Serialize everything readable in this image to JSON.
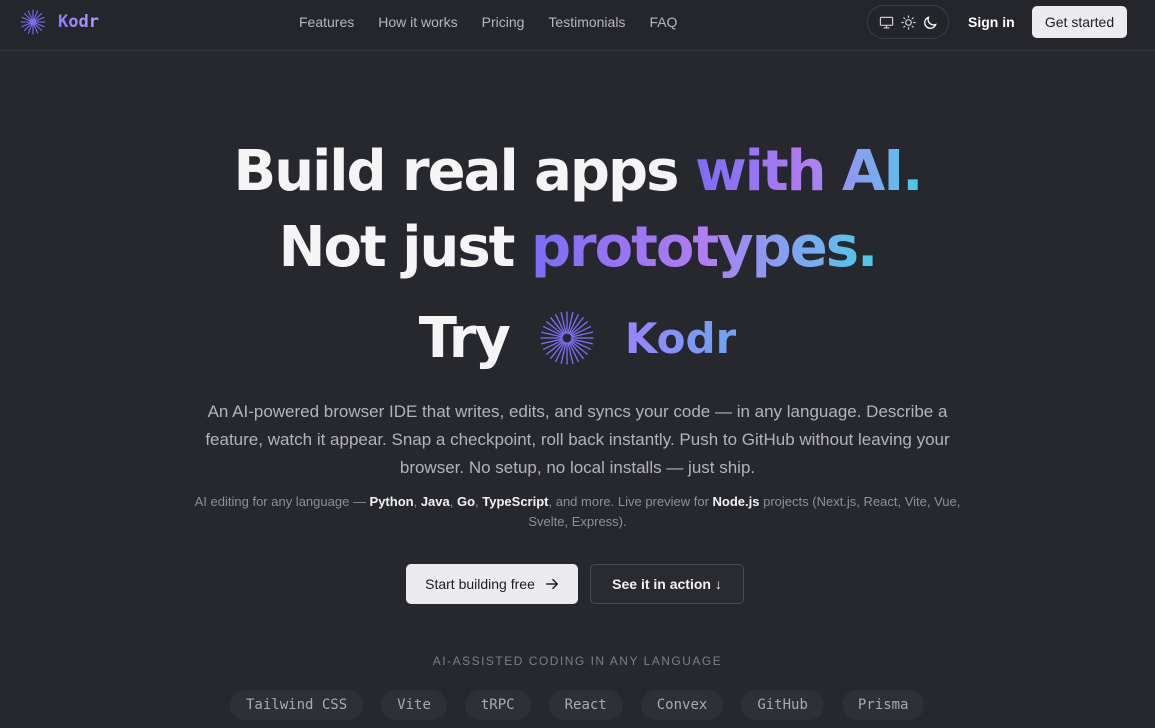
{
  "brand": {
    "name": "Kodr",
    "logo_icon": "starburst-icon"
  },
  "nav": {
    "links": [
      "Features",
      "How it works",
      "Pricing",
      "Testimonials",
      "FAQ"
    ],
    "theme_icons": [
      "monitor-icon",
      "sun-icon",
      "moon-icon"
    ],
    "sign_in": "Sign in",
    "get_started": "Get started"
  },
  "hero": {
    "line1_plain": "Build real apps",
    "line1_accent": "with AI.",
    "line2_plain": "Not just",
    "line2_accent": "prototypes.",
    "try_word": "Try",
    "try_brand": "Kodr",
    "description": "An AI-powered browser IDE that writes, edits, and syncs your code — in any language. Describe a feature, watch it appear. Snap a checkpoint, roll back instantly. Push to GitHub without leaving your browser. No setup, no local installs — just ship.",
    "sub_prefix": "AI editing for any language — ",
    "sub_langs": [
      "Python",
      "Java",
      "Go",
      "TypeScript"
    ],
    "sub_and_more": ", and more. Live preview for ",
    "sub_runtime": "Node.js",
    "sub_suffix": " projects (Next.js, React, Vite, Vue, Svelte, Express).",
    "cta_primary": "Start building free",
    "cta_secondary": "See it in action ↓"
  },
  "tech": {
    "label": "AI-ASSISTED CODING IN ANY LANGUAGE",
    "items": [
      "Tailwind CSS",
      "Vite",
      "tRPC",
      "React",
      "Convex",
      "GitHub",
      "Prisma"
    ]
  },
  "colors": {
    "accent_start": "#7c6cf6",
    "accent_end": "#44cde6",
    "background": "#27282d"
  }
}
